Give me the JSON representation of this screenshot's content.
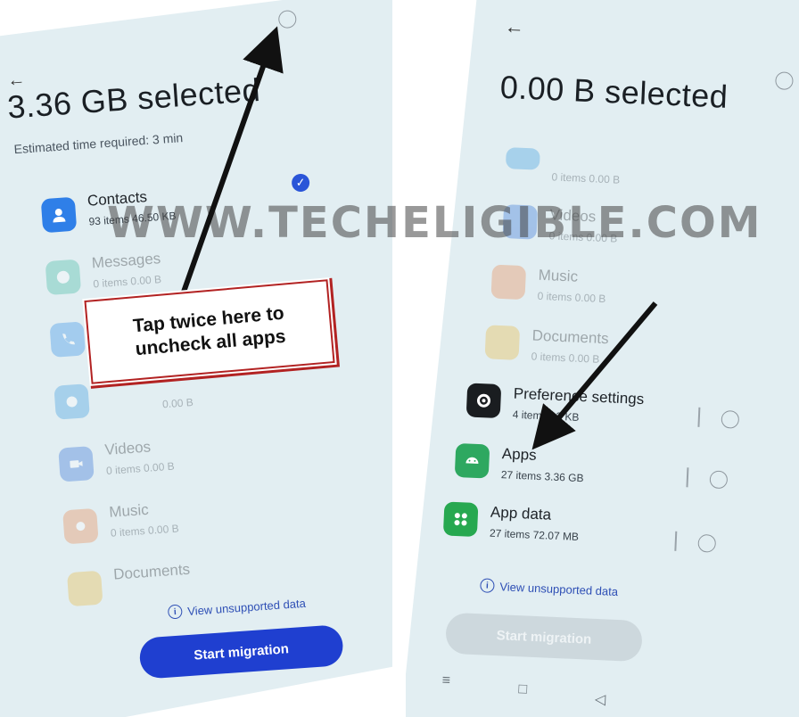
{
  "left_screen": {
    "back_glyph": "←",
    "title": "3.36  GB selected",
    "estimated_time": "Estimated time required: 3 min",
    "items": [
      {
        "name": "Contacts",
        "meta": "93 items   46.50  KB",
        "icon": "contacts-icon",
        "checked": true
      },
      {
        "name": "Messages",
        "meta": "0 items   0.00  B",
        "icon": "messages-icon"
      },
      {
        "name": "",
        "meta": "",
        "icon": "phone-icon"
      },
      {
        "name": "",
        "meta": "0.00 B",
        "icon": "gallery-icon"
      },
      {
        "name": "Videos",
        "meta": "0 items   0.00  B",
        "icon": "videos-icon"
      },
      {
        "name": "Music",
        "meta": "0 items   0.00  B",
        "icon": "music-icon"
      },
      {
        "name": "Documents",
        "meta": "",
        "icon": "documents-icon"
      }
    ],
    "view_unsupported": "View unsupported data",
    "start_button": "Start migration"
  },
  "right_screen": {
    "back_glyph": "←",
    "title": "0.00  B selected",
    "items": [
      {
        "name": "",
        "meta": "0 items   0.00  B",
        "icon": "gallery-icon"
      },
      {
        "name": "Videos",
        "meta": "0 items   0.00  B",
        "icon": "videos-icon"
      },
      {
        "name": "Music",
        "meta": "0 items   0.00  B",
        "icon": "music-icon"
      },
      {
        "name": "Documents",
        "meta": "0 items   0.00  B",
        "icon": "documents-icon"
      },
      {
        "name": "Preference settings",
        "meta": "4 items   93  KB",
        "icon": "gear-icon"
      },
      {
        "name": "Apps",
        "meta": "27 items   3.36  GB",
        "icon": "android-icon"
      },
      {
        "name": "App data",
        "meta": "27 items   72.07  MB",
        "icon": "app-data-icon"
      }
    ],
    "view_unsupported": "View unsupported data",
    "start_button": "Start migration",
    "nav": {
      "menu": "≡",
      "home": "□",
      "back": "◁"
    }
  },
  "callout": {
    "line1": "Tap twice here to",
    "line2": "uncheck all apps"
  },
  "watermark": "WWW.TECHELIGIBLE.COM",
  "colors": {
    "accent_blue": "#2a55d8",
    "callout_border": "#b22222",
    "screen_bg": "#e2eef2",
    "arrow": "#111111"
  },
  "info_glyph": "i",
  "check_glyph": "✓"
}
